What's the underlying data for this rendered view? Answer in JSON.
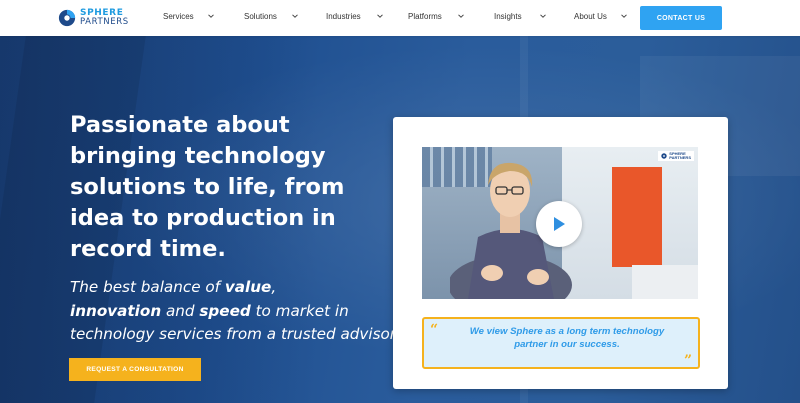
{
  "brand": {
    "line1": "SPHERE",
    "line2": "PARTNERS",
    "primary_color": "#1e4a8a",
    "accent_color": "#2fa3f2"
  },
  "nav": {
    "items": [
      {
        "label": "Services"
      },
      {
        "label": "Solutions"
      },
      {
        "label": "Industries"
      },
      {
        "label": "Platforms"
      },
      {
        "label": "Insights"
      },
      {
        "label": "About Us"
      }
    ],
    "cta_label": "CONTACT US"
  },
  "hero": {
    "headline": "Passionate about bringing technology solutions to life, from idea to production in record time.",
    "sub_parts": [
      "The best balance of ",
      "value",
      ", ",
      "innovation",
      " and ",
      "speed",
      " to market in technology services from a trusted advisor"
    ],
    "consult_label": "REQUEST A CONSULTATION",
    "consult_color": "#f5b21d"
  },
  "video": {
    "watermark_line1": "SPHERE",
    "watermark_line2": "PARTNERS",
    "play_icon": "play-icon"
  },
  "testimonial": {
    "quote": "We view Sphere as a long term technology partner in our success.",
    "quote_open": "“",
    "quote_close": "”"
  }
}
